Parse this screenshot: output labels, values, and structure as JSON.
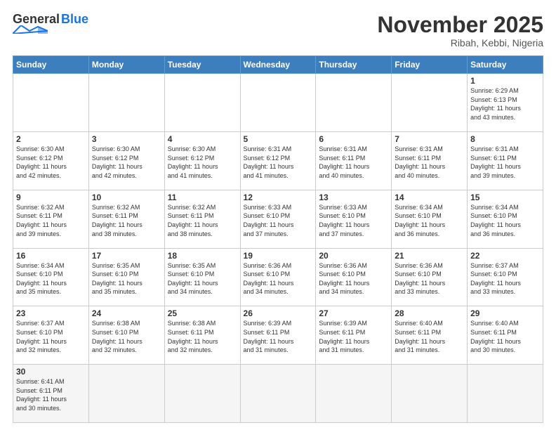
{
  "header": {
    "logo_general": "General",
    "logo_blue": "Blue",
    "month_title": "November 2025",
    "location": "Ribah, Kebbi, Nigeria"
  },
  "days_of_week": [
    "Sunday",
    "Monday",
    "Tuesday",
    "Wednesday",
    "Thursday",
    "Friday",
    "Saturday"
  ],
  "weeks": [
    [
      {
        "day": "",
        "info": ""
      },
      {
        "day": "",
        "info": ""
      },
      {
        "day": "",
        "info": ""
      },
      {
        "day": "",
        "info": ""
      },
      {
        "day": "",
        "info": ""
      },
      {
        "day": "",
        "info": ""
      },
      {
        "day": "1",
        "info": "Sunrise: 6:29 AM\nSunset: 6:13 PM\nDaylight: 11 hours\nand 43 minutes."
      }
    ],
    [
      {
        "day": "2",
        "info": "Sunrise: 6:30 AM\nSunset: 6:12 PM\nDaylight: 11 hours\nand 42 minutes."
      },
      {
        "day": "3",
        "info": "Sunrise: 6:30 AM\nSunset: 6:12 PM\nDaylight: 11 hours\nand 42 minutes."
      },
      {
        "day": "4",
        "info": "Sunrise: 6:30 AM\nSunset: 6:12 PM\nDaylight: 11 hours\nand 41 minutes."
      },
      {
        "day": "5",
        "info": "Sunrise: 6:31 AM\nSunset: 6:12 PM\nDaylight: 11 hours\nand 41 minutes."
      },
      {
        "day": "6",
        "info": "Sunrise: 6:31 AM\nSunset: 6:11 PM\nDaylight: 11 hours\nand 40 minutes."
      },
      {
        "day": "7",
        "info": "Sunrise: 6:31 AM\nSunset: 6:11 PM\nDaylight: 11 hours\nand 40 minutes."
      },
      {
        "day": "8",
        "info": "Sunrise: 6:31 AM\nSunset: 6:11 PM\nDaylight: 11 hours\nand 39 minutes."
      }
    ],
    [
      {
        "day": "9",
        "info": "Sunrise: 6:32 AM\nSunset: 6:11 PM\nDaylight: 11 hours\nand 39 minutes."
      },
      {
        "day": "10",
        "info": "Sunrise: 6:32 AM\nSunset: 6:11 PM\nDaylight: 11 hours\nand 38 minutes."
      },
      {
        "day": "11",
        "info": "Sunrise: 6:32 AM\nSunset: 6:11 PM\nDaylight: 11 hours\nand 38 minutes."
      },
      {
        "day": "12",
        "info": "Sunrise: 6:33 AM\nSunset: 6:10 PM\nDaylight: 11 hours\nand 37 minutes."
      },
      {
        "day": "13",
        "info": "Sunrise: 6:33 AM\nSunset: 6:10 PM\nDaylight: 11 hours\nand 37 minutes."
      },
      {
        "day": "14",
        "info": "Sunrise: 6:34 AM\nSunset: 6:10 PM\nDaylight: 11 hours\nand 36 minutes."
      },
      {
        "day": "15",
        "info": "Sunrise: 6:34 AM\nSunset: 6:10 PM\nDaylight: 11 hours\nand 36 minutes."
      }
    ],
    [
      {
        "day": "16",
        "info": "Sunrise: 6:34 AM\nSunset: 6:10 PM\nDaylight: 11 hours\nand 35 minutes."
      },
      {
        "day": "17",
        "info": "Sunrise: 6:35 AM\nSunset: 6:10 PM\nDaylight: 11 hours\nand 35 minutes."
      },
      {
        "day": "18",
        "info": "Sunrise: 6:35 AM\nSunset: 6:10 PM\nDaylight: 11 hours\nand 34 minutes."
      },
      {
        "day": "19",
        "info": "Sunrise: 6:36 AM\nSunset: 6:10 PM\nDaylight: 11 hours\nand 34 minutes."
      },
      {
        "day": "20",
        "info": "Sunrise: 6:36 AM\nSunset: 6:10 PM\nDaylight: 11 hours\nand 34 minutes."
      },
      {
        "day": "21",
        "info": "Sunrise: 6:36 AM\nSunset: 6:10 PM\nDaylight: 11 hours\nand 33 minutes."
      },
      {
        "day": "22",
        "info": "Sunrise: 6:37 AM\nSunset: 6:10 PM\nDaylight: 11 hours\nand 33 minutes."
      }
    ],
    [
      {
        "day": "23",
        "info": "Sunrise: 6:37 AM\nSunset: 6:10 PM\nDaylight: 11 hours\nand 32 minutes."
      },
      {
        "day": "24",
        "info": "Sunrise: 6:38 AM\nSunset: 6:10 PM\nDaylight: 11 hours\nand 32 minutes."
      },
      {
        "day": "25",
        "info": "Sunrise: 6:38 AM\nSunset: 6:11 PM\nDaylight: 11 hours\nand 32 minutes."
      },
      {
        "day": "26",
        "info": "Sunrise: 6:39 AM\nSunset: 6:11 PM\nDaylight: 11 hours\nand 31 minutes."
      },
      {
        "day": "27",
        "info": "Sunrise: 6:39 AM\nSunset: 6:11 PM\nDaylight: 11 hours\nand 31 minutes."
      },
      {
        "day": "28",
        "info": "Sunrise: 6:40 AM\nSunset: 6:11 PM\nDaylight: 11 hours\nand 31 minutes."
      },
      {
        "day": "29",
        "info": "Sunrise: 6:40 AM\nSunset: 6:11 PM\nDaylight: 11 hours\nand 30 minutes."
      }
    ],
    [
      {
        "day": "30",
        "info": "Sunrise: 6:41 AM\nSunset: 6:11 PM\nDaylight: 11 hours\nand 30 minutes."
      },
      {
        "day": "",
        "info": ""
      },
      {
        "day": "",
        "info": ""
      },
      {
        "day": "",
        "info": ""
      },
      {
        "day": "",
        "info": ""
      },
      {
        "day": "",
        "info": ""
      },
      {
        "day": "",
        "info": ""
      }
    ]
  ]
}
